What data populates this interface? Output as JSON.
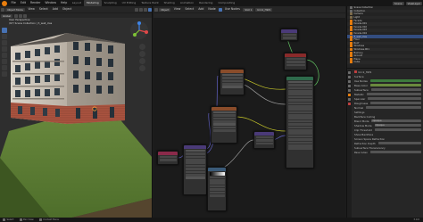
{
  "topbar": {
    "menus": [
      "File",
      "Edit",
      "Render",
      "Window",
      "Help"
    ],
    "workspaces": [
      "Layout",
      "Modeling",
      "Sculpting",
      "UV Editing",
      "Texture Paint",
      "Shading",
      "Animation",
      "Rendering",
      "Compositing"
    ],
    "active_workspace": "Modeling",
    "scene": "Scene",
    "view_layer": "ViewLayer"
  },
  "viewport": {
    "mode": "Object Mode",
    "menus": [
      "View",
      "Select",
      "Add",
      "Object"
    ],
    "orientation": "Global",
    "info_line1": "User Perspective",
    "info_line2": "(67) Scene Collection | 3_wall_clas"
  },
  "node_editor": {
    "type": "Object",
    "menus": [
      "View",
      "Select",
      "Add",
      "Node"
    ],
    "use_nodes_label": "Use Nodes",
    "slot": "Slot 1",
    "material": "brick_HW1",
    "node_titles": [
      "Image Texture",
      "Image Texture",
      "Mapping",
      "Principled BSDF",
      "Material Output",
      "Normal Map",
      "Bump",
      "ColorRamp"
    ]
  },
  "outliner": {
    "items": [
      "Scene Collection",
      "Collection",
      "Camera",
      "Light",
      "Facade",
      "facade.001",
      "facade.002",
      "facade.003",
      "facade.004",
      "3_wall_clas",
      "Floor",
      "Roof",
      "Windows",
      "Windows.001",
      "Balcony",
      "Ground",
      "Plane",
      "Cube"
    ]
  },
  "properties": {
    "material_name": "brick_HW1",
    "rows": [
      "Surface",
      "Use Nodes",
      "Base Color",
      "Subsurface",
      "Metallic",
      "Specular",
      "Roughness",
      "Normal",
      "Settings",
      "Backface Culling",
      "Blend Mode",
      "Shadow Mode",
      "Clip Threshold",
      "Show Backface",
      "Screen Space Refraction",
      "Refraction Depth",
      "Subsurface Translucency",
      "Pass Index"
    ],
    "blend_mode": "Opaque",
    "shadow_mode": "Opaque"
  },
  "statusbar": {
    "left": "Select",
    "mid": "Pan View",
    "right": "Context Menu",
    "version": "3.0.0"
  }
}
